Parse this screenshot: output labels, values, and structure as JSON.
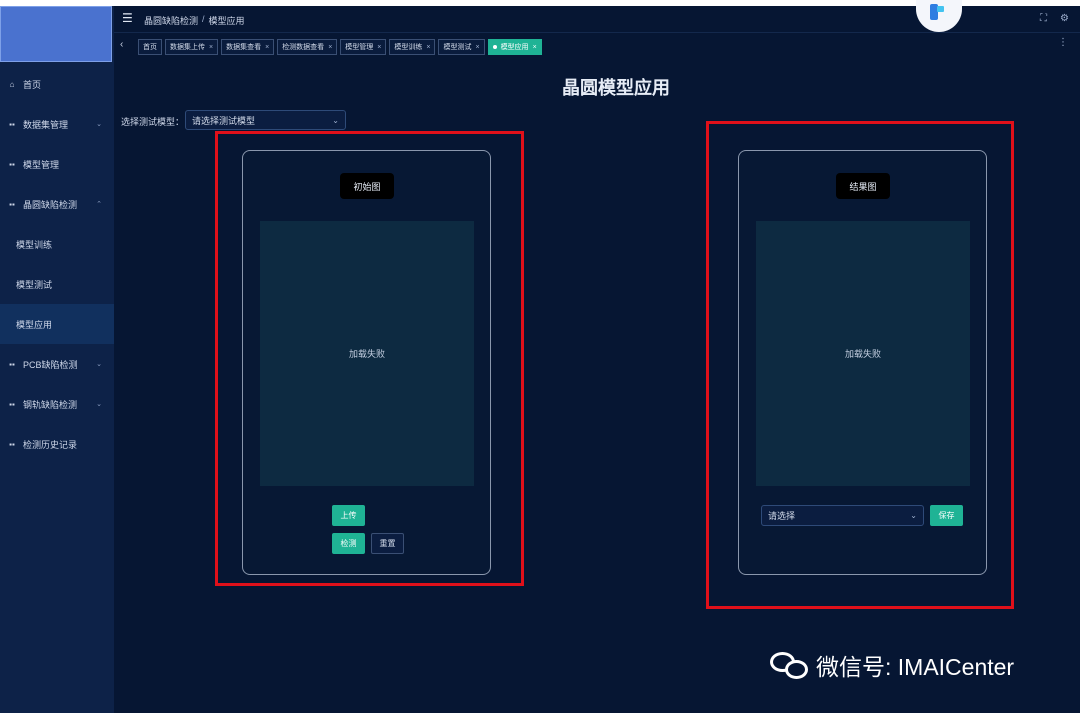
{
  "sidebar": {
    "items": [
      {
        "icon": "home-icon",
        "glyph": "⌂",
        "label": "首页",
        "arrow": ""
      },
      {
        "icon": "grid-icon",
        "glyph": "▪",
        "label": "数据集管理",
        "arrow": "⌄"
      },
      {
        "icon": "grid-icon",
        "glyph": "▪",
        "label": "模型管理",
        "arrow": ""
      },
      {
        "icon": "grid-icon",
        "glyph": "▪",
        "label": "晶圆缺陷检测",
        "arrow": "⌃"
      },
      {
        "icon": "",
        "glyph": "",
        "label": "模型训练",
        "arrow": ""
      },
      {
        "icon": "",
        "glyph": "",
        "label": "模型测试",
        "arrow": ""
      },
      {
        "icon": "",
        "glyph": "",
        "label": "模型应用",
        "arrow": ""
      },
      {
        "icon": "grid-icon",
        "glyph": "▪",
        "label": "PCB缺陷检测",
        "arrow": "⌄"
      },
      {
        "icon": "grid-icon",
        "glyph": "▪",
        "label": "钢轨缺陷检测",
        "arrow": "⌄"
      },
      {
        "icon": "grid-icon",
        "glyph": "▪",
        "label": "检测历史记录",
        "arrow": ""
      }
    ]
  },
  "header": {
    "breadcrumb": [
      "晶圆缺陷检测",
      "模型应用"
    ],
    "breadcrumb_sep": "/"
  },
  "tabs": [
    {
      "label": "首页",
      "close": ""
    },
    {
      "label": "数据集上传",
      "close": "×"
    },
    {
      "label": "数据集查看",
      "close": "×"
    },
    {
      "label": "检测数据查看",
      "close": "×"
    },
    {
      "label": "模型管理",
      "close": "×"
    },
    {
      "label": "模型训练",
      "close": "×"
    },
    {
      "label": "模型测试",
      "close": "×"
    },
    {
      "label": "模型应用",
      "close": "×"
    }
  ],
  "main": {
    "title": "晶圆模型应用",
    "select_label": "选择测试模型：",
    "select_placeholder": "请选择测试模型",
    "left_panel": {
      "title": "初始图",
      "image_status": "加载失败",
      "upload_label": "上传",
      "detect_label": "检测",
      "reset_label": "重置"
    },
    "right_panel": {
      "title": "结果图",
      "image_status": "加载失败",
      "select_placeholder": "请选择",
      "save_label": "保存"
    }
  },
  "watermark": {
    "text": "微信号: IMAICenter"
  },
  "colors": {
    "accent": "#1fb395",
    "sidebar": "#0d2248",
    "background": "#061633",
    "highlight": "#e0101a"
  }
}
